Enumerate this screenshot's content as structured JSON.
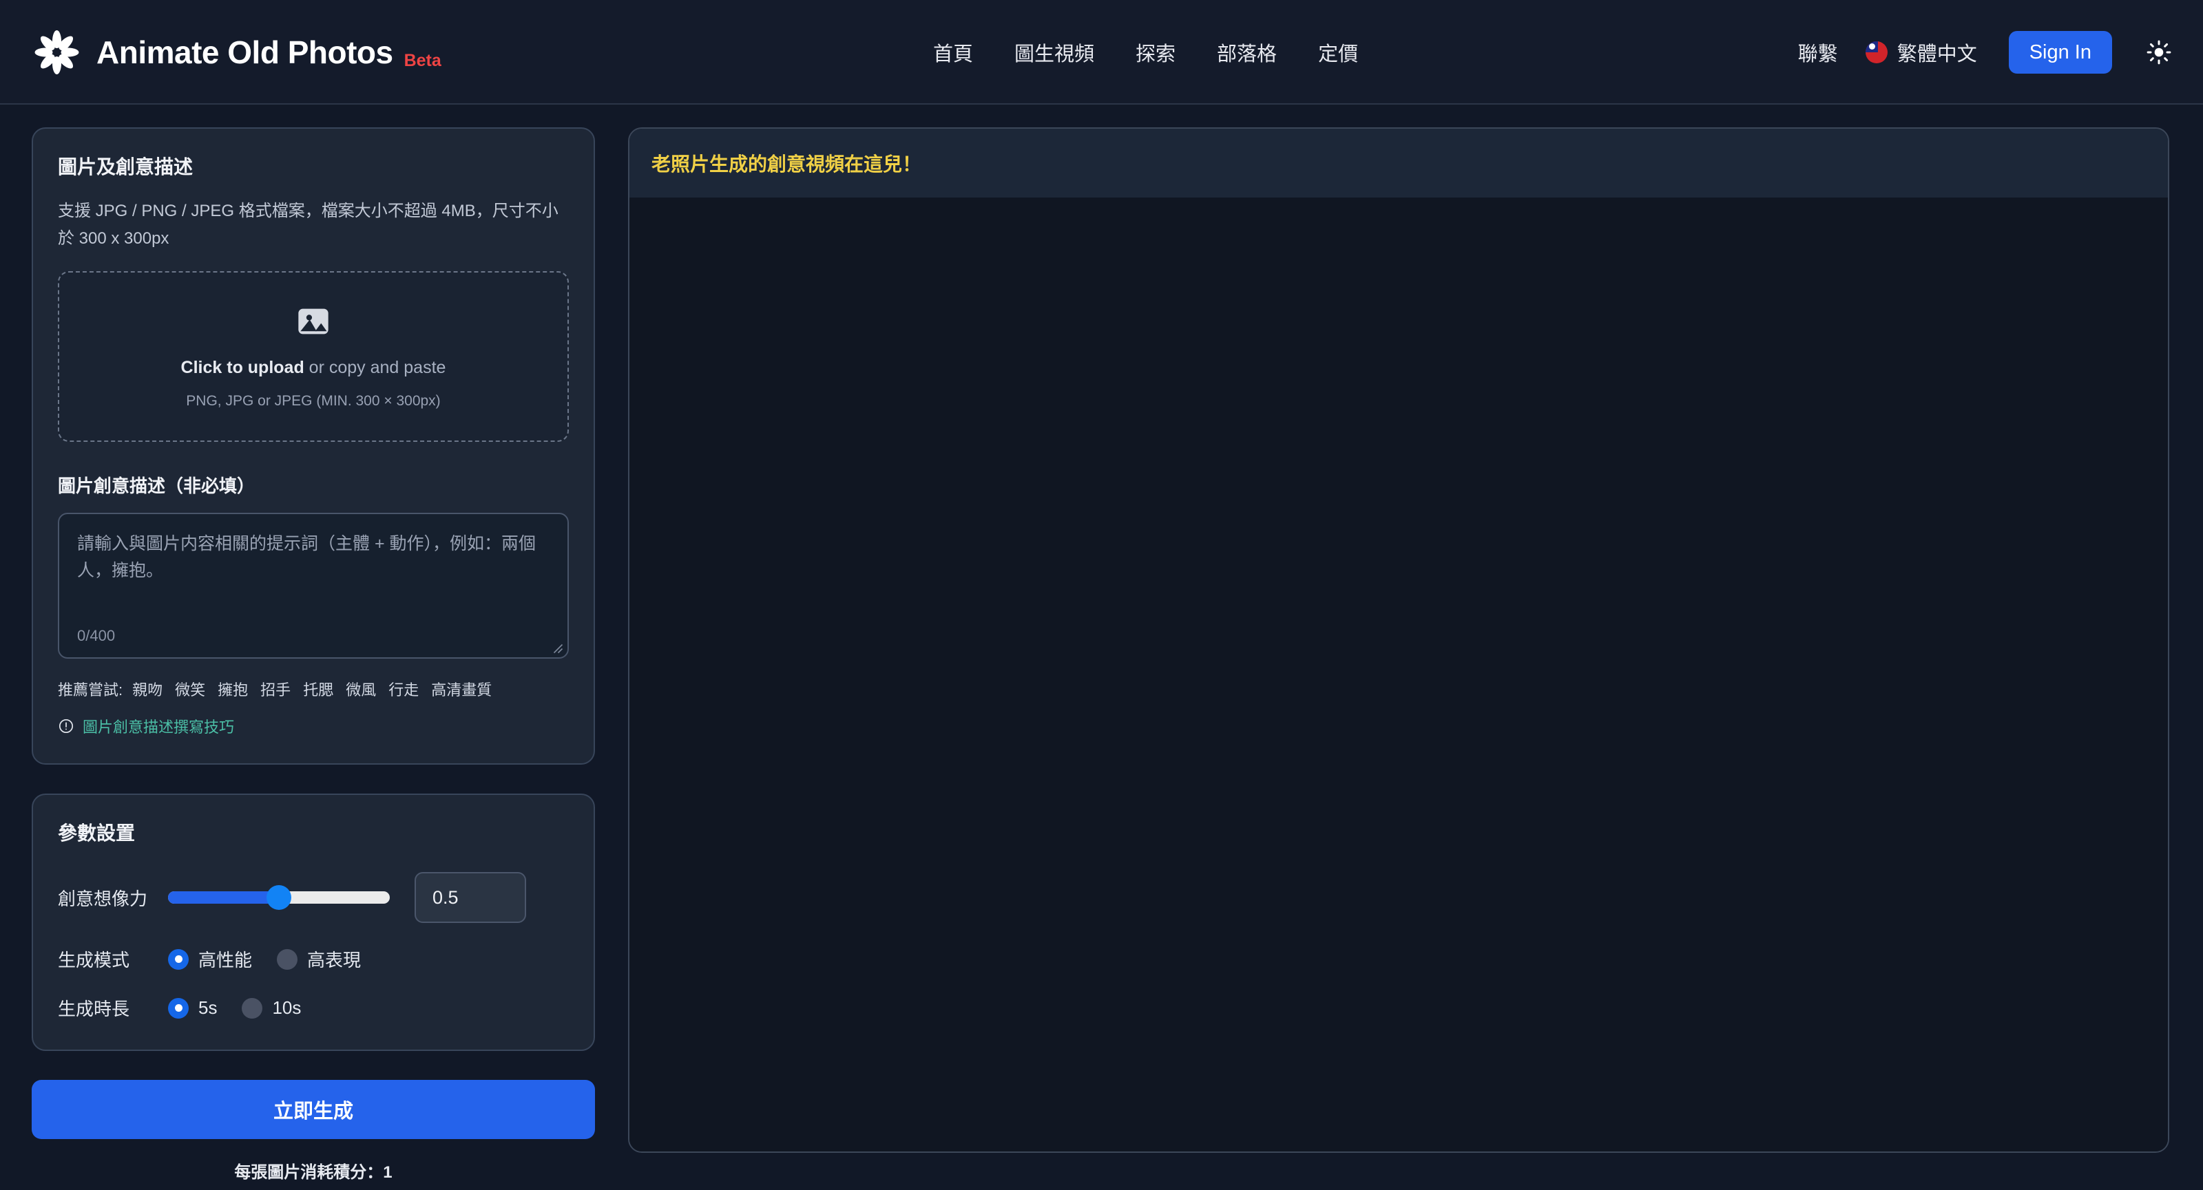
{
  "header": {
    "logo_icon": "flower-logo-icon",
    "brand_title": "Animate Old Photos",
    "badge": "Beta",
    "nav": [
      {
        "label": "首頁"
      },
      {
        "label": "圖生視頻"
      },
      {
        "label": "探索"
      },
      {
        "label": "部落格"
      },
      {
        "label": "定價"
      }
    ],
    "contact_label": "聯繫",
    "language": {
      "flag_icon": "taiwan-flag-icon",
      "label": "繁體中文"
    },
    "signin_label": "Sign In",
    "theme_toggle_icon": "sun-icon"
  },
  "upload_card": {
    "title": "圖片及創意描述",
    "subtitle": "支援 JPG / PNG / JPEG 格式檔案，檔案大小不超過 4MB，尺寸不小於 300 x 300px",
    "dropzone": {
      "icon": "image-placeholder-icon",
      "primary_strong": "Click to upload",
      "primary_rest": " or copy and paste",
      "secondary": "PNG, JPG or JPEG (MIN. 300 × 300px)"
    },
    "prompt_label": "圖片創意描述（非必填）",
    "prompt_placeholder": "請輸入與圖片内容相關的提示詞（主體 + 動作），例如：兩個人，擁抱。",
    "prompt_value": "",
    "prompt_counter": "0/400",
    "suggestions_label": "推薦嘗試:",
    "suggestions": [
      "親吻",
      "微笑",
      "擁抱",
      "招手",
      "托腮",
      "微風",
      "行走",
      "高清畫質"
    ],
    "tips_icon": "info-circle-icon",
    "tips_link": "圖片創意描述撰寫技巧"
  },
  "params_card": {
    "title": "參數設置",
    "imagination": {
      "label": "創意想像力",
      "value": "0.5",
      "percent": 50,
      "min": 0,
      "max": 1
    },
    "mode": {
      "label": "生成模式",
      "options": [
        {
          "label": "高性能",
          "selected": true
        },
        {
          "label": "高表現",
          "selected": false
        }
      ]
    },
    "duration": {
      "label": "生成時長",
      "options": [
        {
          "label": "5s",
          "selected": true
        },
        {
          "label": "10s",
          "selected": false
        }
      ]
    }
  },
  "actions": {
    "generate_label": "立即生成",
    "credit_note": "每張圖片消耗積分：1"
  },
  "result_panel": {
    "header_text": "老照片生成的創意視頻在這兒！",
    "body_text": ""
  },
  "colors": {
    "page_bg": "#111827",
    "card_bg": "#1e2736",
    "accent_blue": "#2563eb",
    "accent_yellow": "#f0d046",
    "accent_red": "#ef4444",
    "accent_teal": "#4bbfa6"
  }
}
